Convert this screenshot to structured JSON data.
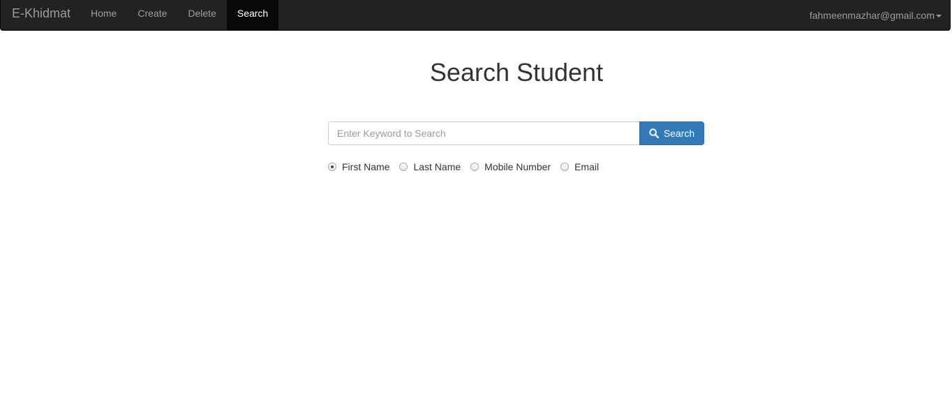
{
  "navbar": {
    "brand": "E-Khidmat",
    "items": [
      {
        "label": "Home",
        "active": false
      },
      {
        "label": "Create",
        "active": false
      },
      {
        "label": "Delete",
        "active": false
      },
      {
        "label": "Search",
        "active": true
      }
    ],
    "user_email": "fahmeenmazhar@gmail.com"
  },
  "page": {
    "title": "Search Student"
  },
  "search": {
    "placeholder": "Enter Keyword to Search",
    "value": "",
    "button_label": "Search"
  },
  "filters": {
    "options": [
      {
        "label": "First Name",
        "checked": true
      },
      {
        "label": "Last Name",
        "checked": false
      },
      {
        "label": "Mobile Number",
        "checked": false
      },
      {
        "label": "Email",
        "checked": false
      }
    ]
  },
  "colors": {
    "navbar_bg": "#222222",
    "nav_active_bg": "#080808",
    "primary": "#337ab7"
  },
  "icons": {
    "search_button": "search-icon",
    "user_dropdown": "caret-down-icon"
  }
}
